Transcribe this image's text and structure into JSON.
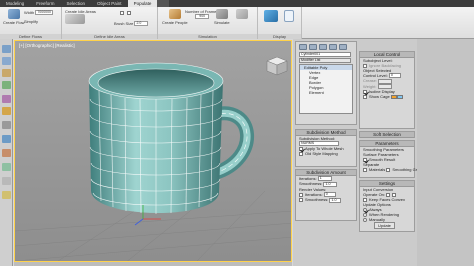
{
  "ribbon_tabs": [
    "Modeling",
    "Freeform",
    "Selection",
    "Object Paint",
    "Populate",
    ""
  ],
  "ribbon": {
    "create_flow": "Create Flow",
    "width_label": "Width",
    "width_value": "7000000",
    "simplify_label": "Simplify",
    "create_idle_areas": "Create Idle Areas",
    "brush_size_label": "Brush Size",
    "brush_size_value": "2.0",
    "create_people": "Create People",
    "number_of_frames_label": "Number of Frames",
    "number_of_frames_value": "900",
    "simulate": "Simulate",
    "display_label": "Display",
    "groups": {
      "define_flows": "Define Flows",
      "define_idle_areas": "Define Idle Areas",
      "simulation": "Simulation",
      "display": "Display"
    }
  },
  "viewport": {
    "label": "[+] [Orthographic] [Realistic]"
  },
  "modify_panel": {
    "object_name": "Cylinder001",
    "modifier_list_label": "Modifier List",
    "stack_items": [
      {
        "label": "Editable Poly",
        "selected": true
      },
      {
        "label": "Vertex",
        "selected": false
      },
      {
        "label": "Edge",
        "selected": false
      },
      {
        "label": "Border",
        "selected": false
      },
      {
        "label": "Polygon",
        "selected": false
      },
      {
        "label": "Element",
        "selected": false
      }
    ]
  },
  "subdivision_method": {
    "title": "Subdivision Method",
    "label": "Subdivision Method:",
    "value": "NURMS",
    "apply_to_whole_mesh": "Apply To Whole Mesh",
    "old_style_mapping": "Old Style Mapping"
  },
  "subdivision_amount": {
    "title": "Subdivision Amount",
    "iterations_label": "Iterations:",
    "iterations_value": "1",
    "smoothness_label": "Smoothness:",
    "smoothness_value": "1.0",
    "render_values_label": "Render Values:",
    "render_iterations_label": "Iterations:",
    "render_iterations_value": "0",
    "render_smoothness_label": "Smoothness:",
    "render_smoothness_value": "1.0"
  },
  "local_control": {
    "title": "Local Control",
    "subobject_level_label": "Subobject Level:",
    "ignore_backfacing": "Ignore Backfacing",
    "object_selected": "Object Selected",
    "control_level_label": "Control Level:",
    "control_level_value": "0",
    "crease_label": "Crease:",
    "weight_label": "Weight:",
    "isoline_display": "Isoline Display",
    "show_cage": "Show Cage",
    "cage_color": "#f2a12a",
    "cage_color2": "#7fc4f0"
  },
  "soft_selection": {
    "title": "Soft Selection"
  },
  "parameters": {
    "title": "Parameters",
    "smoothing_label": "Smoothing Parameters",
    "surface_parameters_label": "Surface Parameters",
    "smooth_result": "Smooth Result",
    "separate_label": "Separate",
    "materials": "Materials",
    "smoothing_groups": "Smoothing Groups"
  },
  "settings": {
    "title": "Settings",
    "input_conversion_label": "Input Conversion",
    "operate_on_label": "Operate On:",
    "preserve_convexity": "Keep Faces Convex",
    "update_options_label": "Update Options",
    "always": "Always",
    "when_rendering": "When Rendering",
    "manually": "Manually",
    "update_button": "Update"
  },
  "colors": {
    "mug_light": "#9fd2cf",
    "mug_dark": "#4f8e8c",
    "wire": "#ffffff",
    "selection_border": "#ffd24a"
  }
}
